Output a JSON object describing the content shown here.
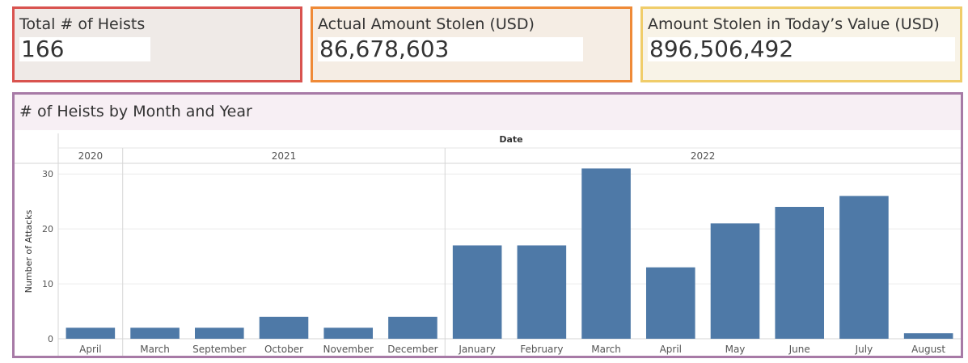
{
  "kpis": {
    "heists": {
      "title": "Total # of Heists",
      "value": "166"
    },
    "actual": {
      "title": "Actual Amount Stolen (USD)",
      "value": "86,678,603"
    },
    "today": {
      "title": "Amount Stolen in Today’s Value (USD)",
      "value": "896,506,492"
    }
  },
  "colors": {
    "bar": "#4e79a7",
    "heists_border": "#d9534f",
    "actual_border": "#ef8a37",
    "today_border": "#f0cd6a",
    "panel_border": "#a77aa6"
  },
  "chart_data": {
    "type": "bar",
    "title": "# of Heists by Month and Year",
    "header_label": "Date",
    "ylabel": "Number of Attacks",
    "ylim": [
      0,
      31.5
    ],
    "yticks": [
      0,
      10,
      20,
      30
    ],
    "grid": true,
    "years": [
      {
        "label": "2020",
        "count": 1
      },
      {
        "label": "2021",
        "count": 5
      },
      {
        "label": "2022",
        "count": 8
      }
    ],
    "categories": [
      "April",
      "March",
      "September",
      "October",
      "November",
      "December",
      "January",
      "February",
      "March",
      "April",
      "May",
      "June",
      "July",
      "August"
    ],
    "values": [
      2,
      2,
      2,
      4,
      2,
      4,
      17,
      17,
      31,
      13,
      21,
      24,
      26,
      1
    ]
  }
}
